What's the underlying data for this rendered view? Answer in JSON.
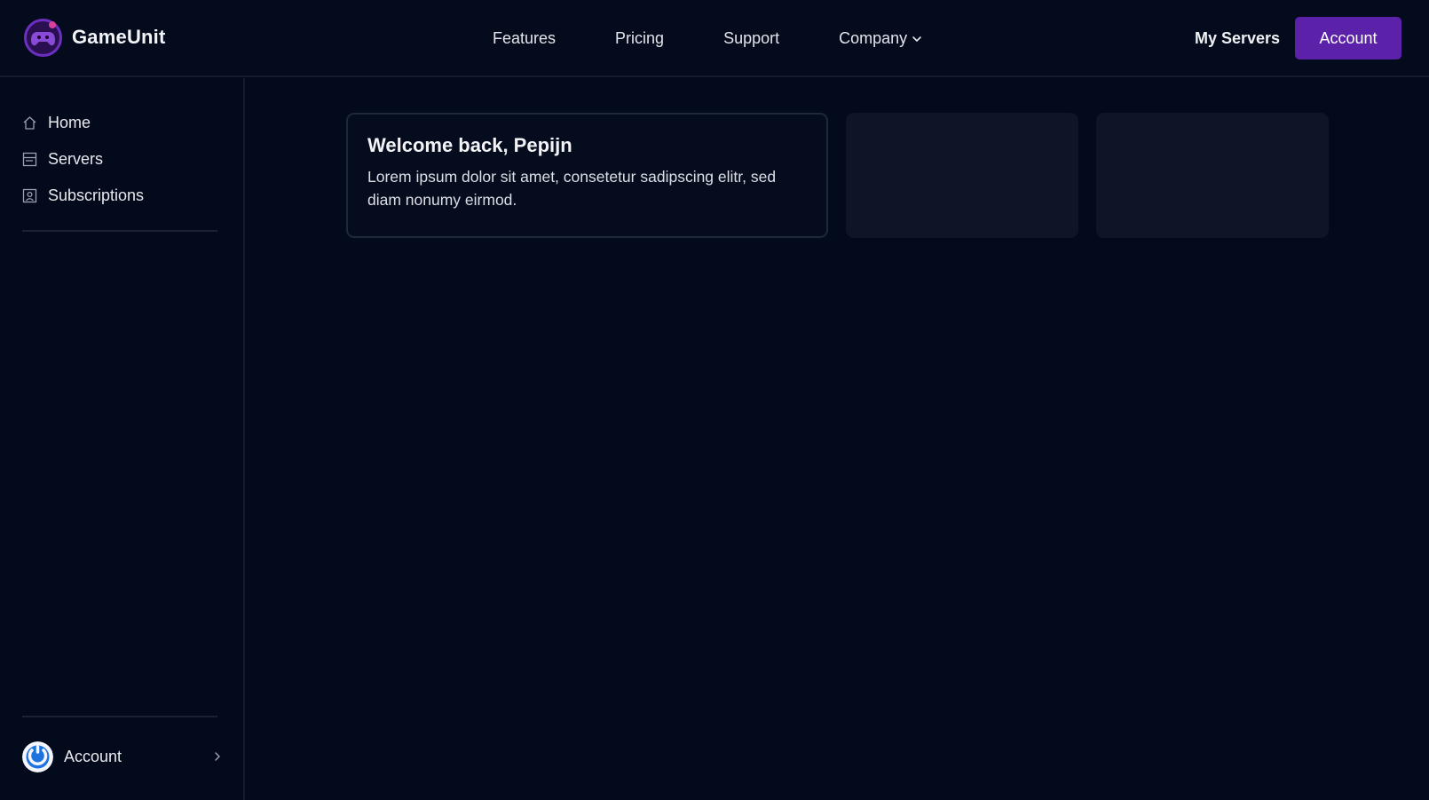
{
  "header": {
    "brand_name": "GameUnit",
    "nav": [
      {
        "label": "Features"
      },
      {
        "label": "Pricing"
      },
      {
        "label": "Support"
      },
      {
        "label": "Company"
      }
    ],
    "my_servers_label": "My Servers",
    "account_label": "Account"
  },
  "sidebar": {
    "items": [
      {
        "label": "Home",
        "icon": "home-icon"
      },
      {
        "label": "Servers",
        "icon": "server-icon"
      },
      {
        "label": "Subscriptions",
        "icon": "subscription-icon"
      }
    ],
    "account_label": "Account"
  },
  "main": {
    "welcome_title": "Welcome back, Pepijn",
    "welcome_body": "Lorem ipsum dolor sit amet, consetetur sadipscing elitr, sed diam nonumy eirmod."
  },
  "colors": {
    "background": "#030a1b",
    "accent": "#5b21a8",
    "card_placeholder": "#0e1526",
    "border": "#141b2c"
  }
}
